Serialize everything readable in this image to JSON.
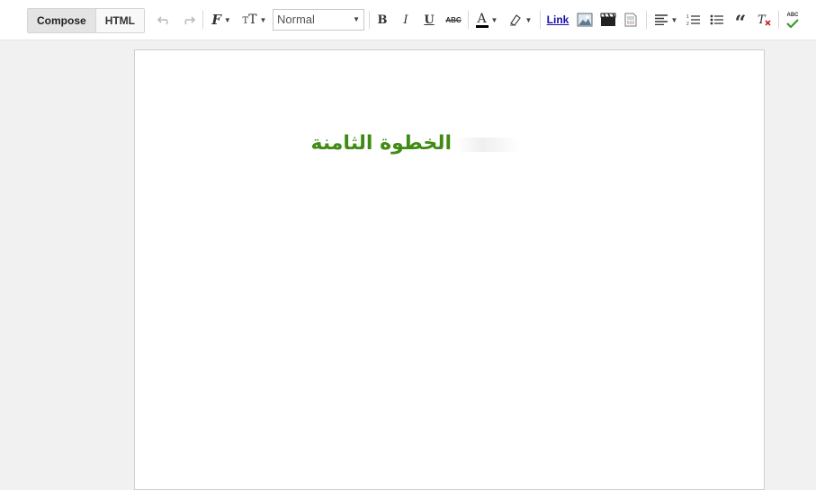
{
  "modes": {
    "compose": "Compose",
    "html": "HTML"
  },
  "toolbar": {
    "style_value": "Normal",
    "bold": "B",
    "italic": "I",
    "underline": "U",
    "strike": "ABC",
    "link": "Link",
    "spellcheck": "ABC",
    "font_color": "#000000",
    "highlight_color": "#ffffff"
  },
  "document": {
    "heading": "الخطوة الثامنة"
  }
}
